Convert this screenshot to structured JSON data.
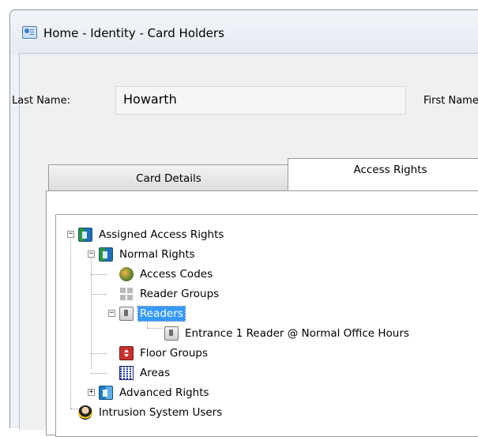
{
  "window": {
    "title": "Home - Identity - Card Holders"
  },
  "form": {
    "last_name_label": "Last Name:",
    "last_name_value": "Howarth",
    "first_name_label": "First Name"
  },
  "tabs": [
    {
      "label": "Card Details",
      "active": false
    },
    {
      "label": "Access Rights",
      "active": true
    }
  ],
  "tree": {
    "root": "Assigned Access Rights",
    "normal_rights": "Normal Rights",
    "access_codes": "Access Codes",
    "reader_groups": "Reader Groups",
    "readers": "Readers",
    "reader_entry": "Entrance 1 Reader @ Normal Office Hours",
    "floor_groups": "Floor Groups",
    "areas": "Areas",
    "advanced_rights": "Advanced Rights",
    "intrusion_users": "Intrusion System Users",
    "selected": "Readers"
  },
  "icons": {
    "window": "card-holders-window-icon",
    "assigned": "door-icon",
    "normal": "door-icon",
    "access_codes": "globe-icon",
    "reader_groups": "reader-group-icon",
    "readers": "reader-icon",
    "reader_entry": "reader-icon",
    "floor_groups": "floor-icon",
    "areas": "area-grid-icon",
    "advanced": "door-icon",
    "intrusion": "intrusion-user-icon"
  },
  "colors": {
    "selection": "#3399ff",
    "frame": "#8a99ad"
  }
}
